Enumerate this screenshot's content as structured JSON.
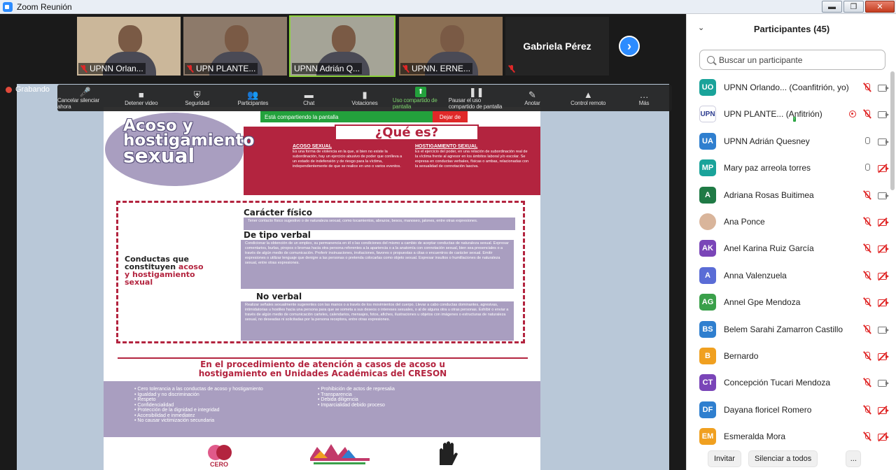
{
  "window": {
    "title": "Zoom Reunión",
    "minimize_label": "▬",
    "restore_label": "❐",
    "close_label": "✕"
  },
  "videos": [
    {
      "name": "UPNN Orlan...",
      "bg": "#cbb79a",
      "muted": true,
      "active": false
    },
    {
      "name": "UPN PLANTE...",
      "bg": "#8d7a6a",
      "muted": true,
      "active": false
    },
    {
      "name": "UPNN Adrián Q...",
      "bg": "#a5a497",
      "muted": false,
      "active": true
    },
    {
      "name": "UPNN. ERNE...",
      "bg": "#8b6f54",
      "muted": true,
      "active": false
    }
  ],
  "name_tile": {
    "name": "Gabriela Pérez"
  },
  "next_label": "›",
  "recording": {
    "label": "Grabando"
  },
  "toolbar": [
    {
      "label": "Cancelar silenciar ahora",
      "icon": "🎤"
    },
    {
      "label": "Detener video",
      "icon": "■"
    },
    {
      "label": "Seguridad",
      "icon": "⛨"
    },
    {
      "label": "Participantes",
      "icon": "👥"
    },
    {
      "label": "Chat",
      "icon": "▬"
    },
    {
      "label": "Votaciones",
      "icon": "▮"
    },
    {
      "label": "Uso compartido de pantalla",
      "icon": "⬆"
    },
    {
      "label": "Pausar el uso compartido de pantalla",
      "icon": "❚❚"
    },
    {
      "label": "Anotar",
      "icon": "✎"
    },
    {
      "label": "Control remoto",
      "icon": "▲"
    },
    {
      "label": "Más",
      "icon": "…"
    }
  ],
  "share_bar": {
    "status": "Está compartiendo la pantalla",
    "stop": "Dejar de"
  },
  "poster": {
    "title_line1": "Acoso y",
    "title_line2": "hostigamiento",
    "title_line3": "sexual",
    "whatis": "¿Qué es?",
    "def1_title": "ACOSO SEXUAL",
    "def1_text": "Es una forma de violencia en la que, si bien no existe la subordinación, hay un ejercicio abusivo de poder que conlleva a un estado de indefensión y de riesgo para la víctima, independientemente de que se realice en uno o varios eventos.",
    "def2_title": "HOSTIGAMIENTO SEXUAL",
    "def2_text": "Es el ejercicio del poder, en una relación de subordinación real de la víctima frente al agresor en los ámbitos laboral y/o escolar. Se expresa en conductas verbales, físicas o ambas, relacionadas con la sexualidad de connotación lasciva.",
    "conducts_a": "Conductas que",
    "conducts_b": "constituyen",
    "conducts_c": "acoso",
    "conducts_d": "y hostigamiento",
    "conducts_e": "sexual",
    "sec1": "Carácter físico",
    "sec1_text": "Tener contacto físico sugestivo o de naturaleza sexual, como tocamientos, abrazos, besos, manoseo, jalones, entre otras expresiones.",
    "sec2": "De tipo verbal",
    "sec2_text": "Condicionar la obtención de un empleo, su permanencia en él o las condiciones del mismo a cambio de aceptar conductas de naturaleza sexual. Expresar comentarios, burlas, piropos o bromas hacia otra persona referentes a la apariencia o a la anatomía con connotación sexual, bien sea presenciales o a través de algún medio de comunicación. Proferir insinuaciones, invitaciones, favores o propuestas a citas o encuentros de carácter sexual. Emitir expresiones o utilizar lenguaje que denigre a las personas o pretenda colocarlas como objeto sexual. Expresar insultos o humillaciones de naturaleza sexual, entre otras expresiones.",
    "sec3": "No verbal",
    "sec3_text": "Realizar señales sexualmente sugerentes con las manos o a través de los movimientos del cuerpo. Llevar a cabo conductas dominantes, agresivas, intimidatorias u hostiles hacia una persona para que se someta a sus deseos o intereses sexuales, o al de alguna otra u otras personas. Exhibir o enviar a través de algún medio de comunicación carteles, calendarios, mensajes, fotos, afiches, ilustraciones u objetos con imágenes o estructuras de naturaleza sexual, no deseadas ni solicitadas por la persona receptora, entre otras expresiones.",
    "proc_title_1": "En el procedimiento de atención a casos de acoso u",
    "proc_title_2": "hostigamiento en Unidades Académicas del CRESON",
    "principles_left": [
      "Cero tolerancia a las conductas de acoso y hostigamiento",
      "Igualdad y no discriminación",
      "Respeto",
      "Confidencialidad",
      "Protección de la dignidad e integridad",
      "Accesibilidad e inmediatez",
      "No causar victimización secundaria"
    ],
    "principles_right": [
      "Prohibición de actos de represalia",
      "Transparencia",
      "Debida diligencia",
      "Imparcialidad debido proceso"
    ],
    "logo1": "CERO",
    "colors": {
      "red": "#b3243f",
      "lavender": "#a99ec0"
    }
  },
  "participants_panel": {
    "title": "Participantes (45)",
    "search_placeholder": "Buscar un participante",
    "invite": "Invitar",
    "mute_all": "Silenciar a todos",
    "more": "..."
  },
  "participants": [
    {
      "initials": "UO",
      "color": "#1aa39a",
      "name": "UPNN Orlando... (Coanfitrión, yo)",
      "mic": "off",
      "cam": "on"
    },
    {
      "initials": "UPN",
      "color": "#ffffff",
      "name": "UPN PLANTE... (Anfitrión)",
      "mic": "off",
      "cam": "on",
      "sharing": true,
      "recording": true
    },
    {
      "initials": "UA",
      "color": "#2f7fcf",
      "name": "UPNN Adrián Quesney",
      "mic": "on",
      "cam": "on"
    },
    {
      "initials": "MP",
      "color": "#1aa39a",
      "name": "Mary paz arreola torres",
      "mic": "on",
      "cam": "off"
    },
    {
      "initials": "A",
      "color": "#1f7a45",
      "name": "Adriana Rosas Buitimea",
      "mic": "off",
      "cam": "on"
    },
    {
      "initials": "",
      "color": "#d9b59b",
      "name": "Ana Ponce",
      "mic": "off",
      "cam": "off"
    },
    {
      "initials": "AK",
      "color": "#7a45b8",
      "name": "Anel Karina Ruiz García",
      "mic": "off",
      "cam": "off"
    },
    {
      "initials": "A",
      "color": "#5a6cd6",
      "name": "Anna Valenzuela",
      "mic": "off",
      "cam": "off"
    },
    {
      "initials": "AG",
      "color": "#3aa04a",
      "name": "Annel Gpe Mendoza",
      "mic": "off",
      "cam": "off"
    },
    {
      "initials": "BS",
      "color": "#2f7fcf",
      "name": "Belem Sarahi Zamarron Castillo",
      "mic": "off",
      "cam": "on"
    },
    {
      "initials": "B",
      "color": "#f0a020",
      "name": "Bernardo",
      "mic": "off",
      "cam": "off"
    },
    {
      "initials": "CT",
      "color": "#7a45b8",
      "name": "Concepción Tucari Mendoza",
      "mic": "off",
      "cam": "on"
    },
    {
      "initials": "DF",
      "color": "#2f7fcf",
      "name": "Dayana floricel Romero",
      "mic": "off",
      "cam": "off"
    },
    {
      "initials": "EM",
      "color": "#f0a020",
      "name": "Esmeralda Mora",
      "mic": "off",
      "cam": "off"
    }
  ]
}
